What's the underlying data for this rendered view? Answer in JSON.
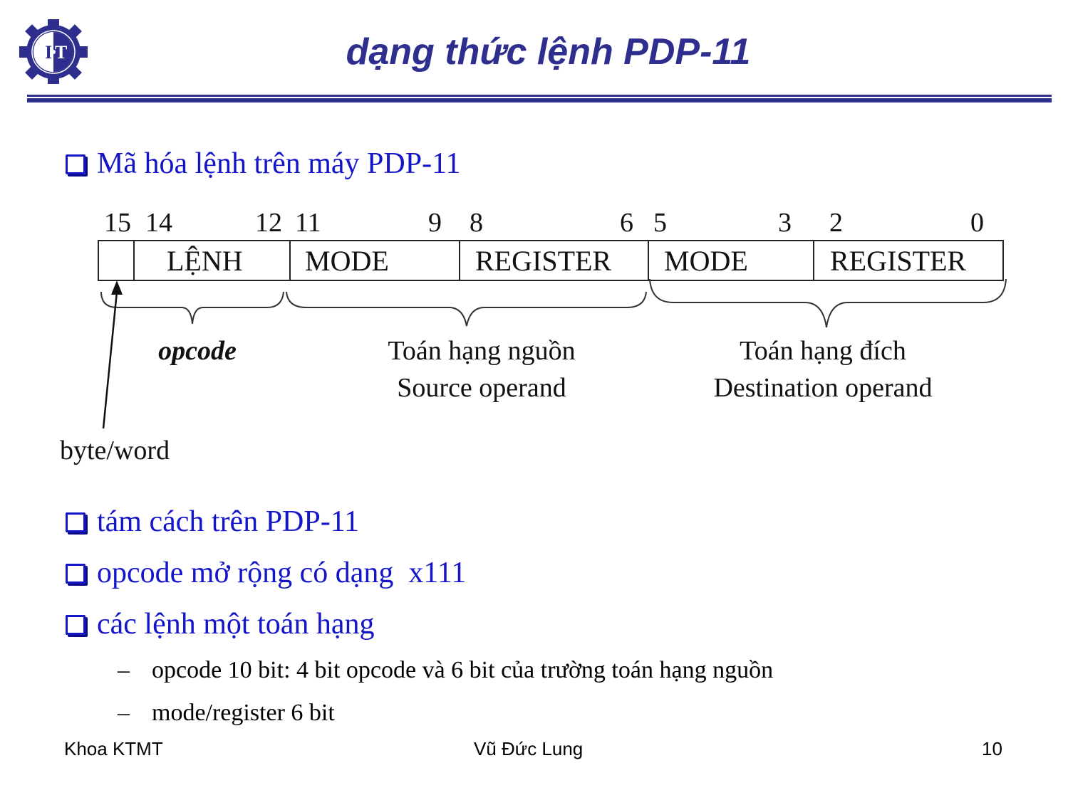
{
  "header": {
    "logo_text": "I·T",
    "title": "dạng thức lệnh PDP-11",
    "brand_color": "#2e2e8f"
  },
  "bullets": [
    {
      "icon": "square-bullet-icon",
      "text": "Mã hóa lệnh trên máy PDP-11"
    },
    {
      "icon": "square-bullet-icon",
      "text": "tám cách trên PDP-11"
    },
    {
      "icon": "square-bullet-icon",
      "text": "opcode mở rộng có dạng  x111"
    },
    {
      "icon": "square-bullet-icon",
      "text": "các lệnh một toán hạng"
    }
  ],
  "sub_bullets": [
    {
      "dash": "–",
      "text": "opcode 10 bit: 4 bit opcode và 6 bit của trường toán hạng nguồn"
    },
    {
      "dash": "–",
      "text": "mode/register 6 bit"
    }
  ],
  "diagram": {
    "bit_labels": [
      "15",
      "14",
      "12",
      "11",
      "9",
      "8",
      "6",
      "5",
      "3",
      "2",
      "0"
    ],
    "fields": [
      {
        "label": "",
        "bits": "15"
      },
      {
        "label": "LỆNH",
        "bits": "14-12"
      },
      {
        "label": "MODE",
        "bits": "11-9"
      },
      {
        "label": "REGISTER",
        "bits": "8-6"
      },
      {
        "label": "MODE",
        "bits": "5-3"
      },
      {
        "label": "REGISTER",
        "bits": "2-0"
      }
    ],
    "opcode_label": "opcode",
    "source_label_vi": "Toán hạng nguồn",
    "source_label_en": "Source operand",
    "dest_label_vi": "Toán hạng đích",
    "dest_label_en": "Destination operand",
    "byte_word_label": "byte/word"
  },
  "footer": {
    "left": "Khoa KTMT",
    "center": "Vũ Đức Lung",
    "page": "10"
  }
}
